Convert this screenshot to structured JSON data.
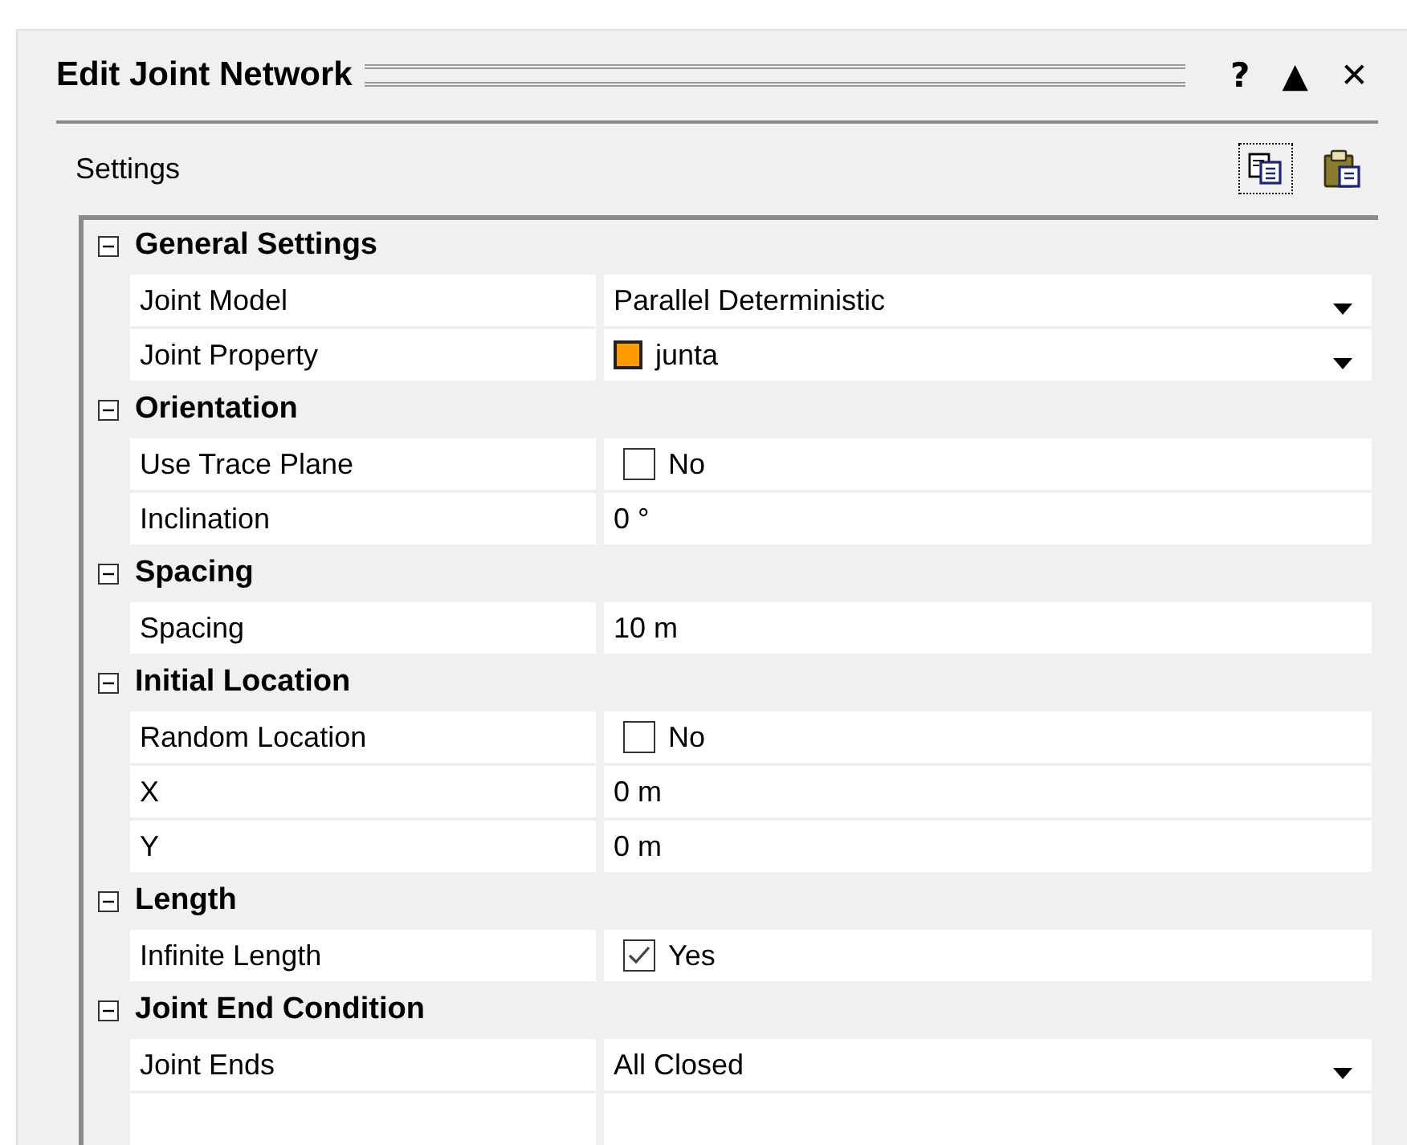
{
  "panel": {
    "title": "Edit Joint Network",
    "buttons": [
      "?",
      "▲",
      "✕"
    ]
  },
  "settings": {
    "label": "Settings"
  },
  "groups": [
    {
      "title": "General Settings",
      "expanded": true,
      "properties": [
        {
          "name": "Joint Model",
          "kind": "dropdown",
          "value": "Parallel Deterministic"
        },
        {
          "name": "Joint Property",
          "kind": "color-dropdown",
          "value": "junta",
          "color": "#ff9900"
        }
      ]
    },
    {
      "title": "Orientation",
      "expanded": true,
      "properties": [
        {
          "name": "Use Trace Plane",
          "kind": "checkbox",
          "value": "No",
          "checked": false
        },
        {
          "name": "Inclination",
          "kind": "text",
          "value": "0 °"
        }
      ]
    },
    {
      "title": "Spacing",
      "expanded": true,
      "properties": [
        {
          "name": "Spacing",
          "kind": "text",
          "value": "10 m"
        }
      ]
    },
    {
      "title": "Initial Location",
      "expanded": true,
      "properties": [
        {
          "name": "Random Location",
          "kind": "checkbox",
          "value": "No",
          "checked": false
        },
        {
          "name": "X",
          "kind": "text",
          "value": "0 m"
        },
        {
          "name": "Y",
          "kind": "text",
          "value": "0 m"
        }
      ]
    },
    {
      "title": "Length",
      "expanded": true,
      "properties": [
        {
          "name": "Infinite Length",
          "kind": "checkbox",
          "value": "Yes",
          "checked": true
        }
      ]
    },
    {
      "title": "Joint End Condition",
      "expanded": true,
      "properties": [
        {
          "name": "Joint Ends",
          "kind": "dropdown",
          "value": "All Closed"
        }
      ]
    }
  ]
}
